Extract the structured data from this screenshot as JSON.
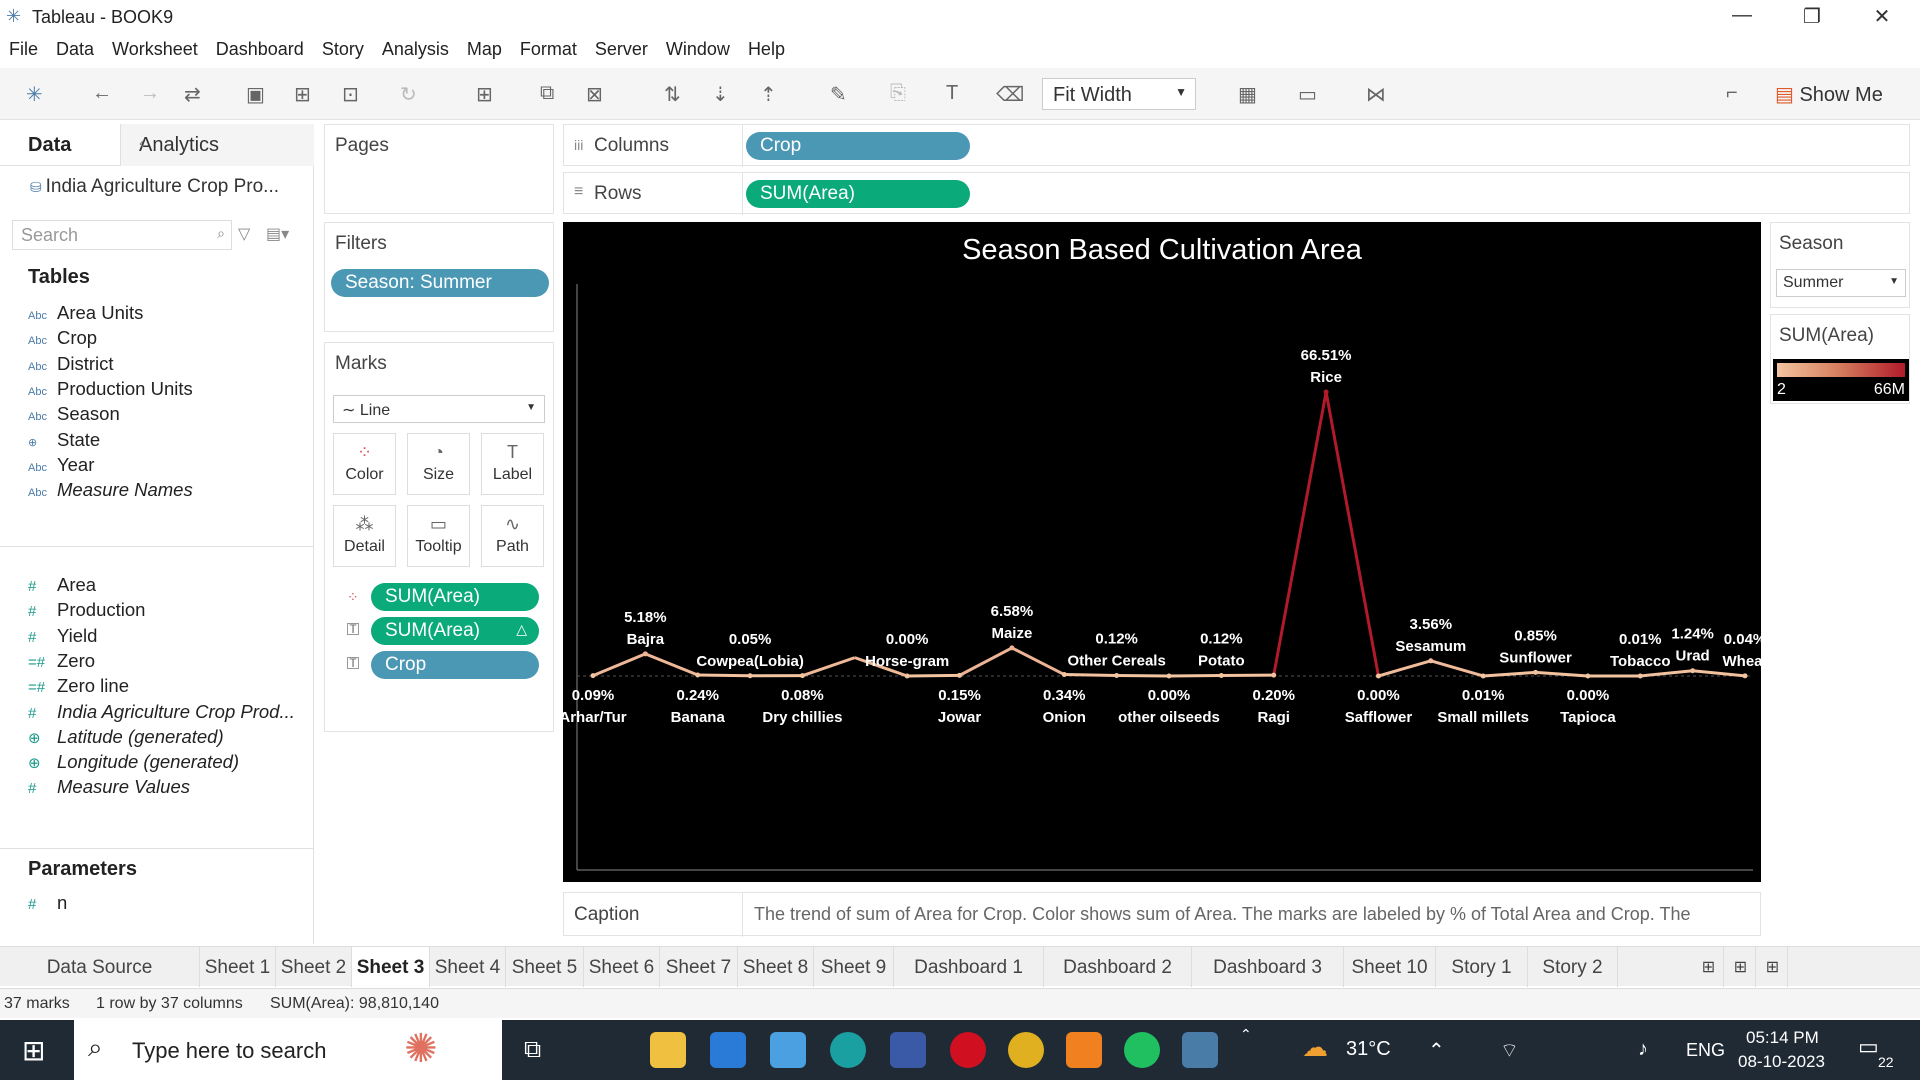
{
  "window": {
    "title": "Tableau - BOOK9",
    "controls": [
      "—",
      "❐",
      "✕"
    ]
  },
  "menu": [
    "File",
    "Data",
    "Worksheet",
    "Dashboard",
    "Story",
    "Analysis",
    "Map",
    "Format",
    "Server",
    "Window",
    "Help"
  ],
  "toolbar": {
    "fit": "Fit Width",
    "show_me": "Show Me"
  },
  "left": {
    "tab_data": "Data",
    "tab_analytics": "Analytics",
    "datasource": "India Agriculture Crop Pro...",
    "search_placeholder": "Search",
    "tables_label": "Tables",
    "dims": [
      {
        "type": "Abc",
        "name": "Area Units"
      },
      {
        "type": "Abc",
        "name": "Crop"
      },
      {
        "type": "Abc",
        "name": "District"
      },
      {
        "type": "Abc",
        "name": "Production Units"
      },
      {
        "type": "Abc",
        "name": "Season"
      },
      {
        "type": "⊕",
        "name": "State"
      },
      {
        "type": "Abc",
        "name": "Year"
      },
      {
        "type": "Abc",
        "name": "Measure Names"
      }
    ],
    "measures": [
      {
        "type": "#",
        "name": "Area"
      },
      {
        "type": "#",
        "name": "Production"
      },
      {
        "type": "#",
        "name": "Yield"
      },
      {
        "type": "=#",
        "name": "Zero"
      },
      {
        "type": "=#",
        "name": "Zero line"
      },
      {
        "type": "#",
        "name": "India Agriculture Crop Prod..."
      },
      {
        "type": "⊕",
        "name": "Latitude (generated)"
      },
      {
        "type": "⊕",
        "name": "Longitude (generated)"
      },
      {
        "type": "#",
        "name": "Measure Values"
      }
    ],
    "params_label": "Parameters",
    "params": [
      {
        "type": "#",
        "name": "n"
      }
    ]
  },
  "cards": {
    "pages": "Pages",
    "filters": "Filters",
    "filter_pill": "Season: Summer",
    "marks": "Marks",
    "mark_type": "Line",
    "mark_buttons": [
      "Color",
      "Size",
      "Label",
      "Detail",
      "Tooltip",
      "Path"
    ],
    "mark_pills": [
      "SUM(Area)",
      "SUM(Area)",
      "Crop"
    ]
  },
  "shelves": {
    "columns_label": "Columns",
    "columns_pill": "Crop",
    "rows_label": "Rows",
    "rows_pill": "SUM(Area)"
  },
  "chart_data": {
    "type": "line",
    "title": "Season Based Cultivation Area",
    "categories": [
      "Arhar/Tur",
      "Bajra",
      "Banana",
      "Cowpea(Lobia)",
      "Dry chillies",
      "Horse-gram",
      "Jowar",
      "Maize",
      "Onion",
      "Other Cereals",
      "other oilseeds",
      "Potato",
      "Ragi",
      "Rice",
      "Safflower",
      "Sesamum",
      "Small millets",
      "Sunflower",
      "Tapioca",
      "Tobacco",
      "Urad",
      "Wheat"
    ],
    "series": [
      {
        "values_pct": [
          0.09,
          5.18,
          0.24,
          0.05,
          0.08,
          0.0,
          0.15,
          6.58,
          0.34,
          0.12,
          0.0,
          0.12,
          0.2,
          66.51,
          0.0,
          3.56,
          0.01,
          0.85,
          0.0,
          0.01,
          1.24,
          0.04
        ]
      }
    ],
    "unlabeled_peak_between": [
      "Dry chillies",
      "Horse-gram"
    ],
    "legend": {
      "title": "SUM(Area)",
      "min": "2",
      "max": "66M"
    },
    "colors": {
      "low": "#f3c4a0",
      "high": "#b11a2a",
      "background": "#000000"
    }
  },
  "caption": {
    "label": "Caption",
    "text": "The trend of sum of Area for Crop.  Color shows sum of Area.  The marks are labeled by % of Total Area and Crop. The"
  },
  "right": {
    "season_title": "Season",
    "season_value": "Summer",
    "legend_title": "SUM(Area)"
  },
  "sheets": [
    "Data Source",
    "Sheet 1",
    "Sheet 2",
    "Sheet 3",
    "Sheet 4",
    "Sheet 5",
    "Sheet 6",
    "Sheet 7",
    "Sheet 8",
    "Sheet 9",
    "Dashboard 1",
    "Dashboard 2",
    "Dashboard 3",
    "Sheet 10",
    "Story 1",
    "Story 2"
  ],
  "active_sheet": "Sheet 3",
  "status": {
    "marks": "37 marks",
    "dims": "1 row by 37 columns",
    "sum": "SUM(Area): 98,810,140"
  },
  "taskbar": {
    "search": "Type here to search",
    "temp": "31°C",
    "lang": "ENG",
    "time": "05:14 PM",
    "date": "08-10-2023",
    "notif": "22"
  }
}
